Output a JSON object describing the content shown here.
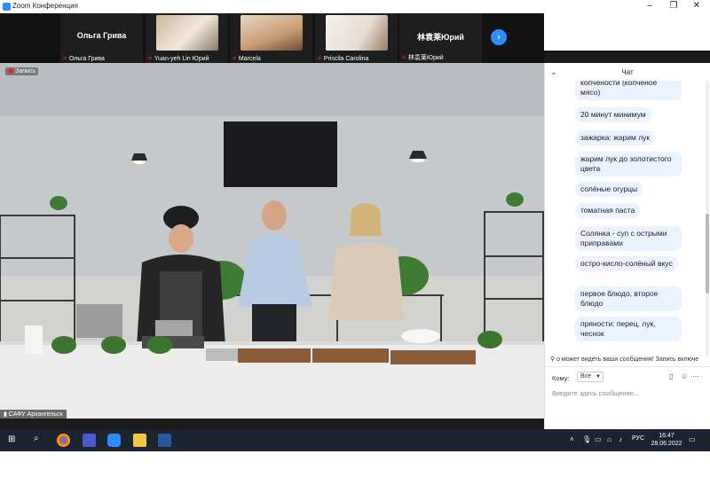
{
  "window": {
    "title": "Zoom Конференция"
  },
  "gallery": {
    "tiles": [
      {
        "big_name": "Ольга Грива",
        "caption": "Ольга Грива"
      },
      {
        "big_name": "",
        "caption": "Yuan-yeh Lin Юрий"
      },
      {
        "big_name": "",
        "caption": "Marcela"
      },
      {
        "big_name": "",
        "caption": "Priscila Carolina"
      },
      {
        "big_name": "林袁莱Юрий",
        "caption": "林袁莱Юрий"
      }
    ]
  },
  "video": {
    "recording_label": "Запись",
    "speaker_label": "САФУ Архангельск"
  },
  "chat": {
    "title": "Чат",
    "messages": [
      "копчености (копченое мясо)",
      "20 минут минимум",
      "зажарка: жарим лук",
      "жарим лук до золотистого цвета",
      "солёные огурцы",
      "томатная паста",
      "Солянка - суп с острыми приправами",
      "остро-кисло-солёный вкус",
      "первое блюдо, второе блюдо",
      "пряности: перец, лук, чеснок"
    ],
    "notice": "о может видеть ваши сообщения! Запись включе",
    "to_label": "Кому:",
    "to_value": "Все",
    "input_placeholder": "Введите здесь сообщение..."
  },
  "taskbar": {
    "lang": "РУС",
    "time": "16:47",
    "date": "28.06.2022"
  },
  "colors": {
    "accent": "#2d8cff",
    "taskbar": "#1c2430",
    "chat_bubble": "#eaf3ff",
    "mic_off": "#e02828"
  }
}
